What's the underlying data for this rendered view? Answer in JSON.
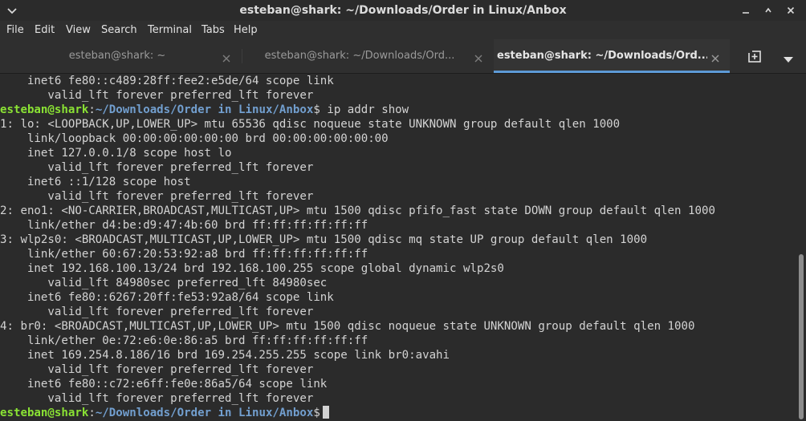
{
  "window": {
    "title": "esteban@shark: ~/Downloads/Order in Linux/Anbox"
  },
  "menu": [
    "File",
    "Edit",
    "View",
    "Search",
    "Terminal",
    "Tabs",
    "Help"
  ],
  "tabs": [
    {
      "label": "esteban@shark: ~",
      "active": false
    },
    {
      "label": "esteban@shark: ~/Downloads/Ord...",
      "active": false
    },
    {
      "label": "esteban@shark: ~/Downloads/Ord...",
      "active": true
    }
  ],
  "prompt": {
    "user_host": "esteban@shark",
    "sep": ":",
    "path": "~/Downloads/Order in Linux/Anbox",
    "dollar": "$"
  },
  "command": " ip addr show",
  "output_before": [
    "    inet6 fe80::c489:28ff:fee2:e5de/64 scope link",
    "       valid_lft forever preferred_lft forever"
  ],
  "output": [
    "1: lo: <LOOPBACK,UP,LOWER_UP> mtu 65536 qdisc noqueue state UNKNOWN group default qlen 1000",
    "    link/loopback 00:00:00:00:00:00 brd 00:00:00:00:00:00",
    "    inet 127.0.0.1/8 scope host lo",
    "       valid_lft forever preferred_lft forever",
    "    inet6 ::1/128 scope host",
    "       valid_lft forever preferred_lft forever",
    "2: eno1: <NO-CARRIER,BROADCAST,MULTICAST,UP> mtu 1500 qdisc pfifo_fast state DOWN group default qlen 1000",
    "    link/ether d4:be:d9:47:4b:60 brd ff:ff:ff:ff:ff:ff",
    "3: wlp2s0: <BROADCAST,MULTICAST,UP,LOWER_UP> mtu 1500 qdisc mq state UP group default qlen 1000",
    "    link/ether 60:67:20:53:92:a8 brd ff:ff:ff:ff:ff:ff",
    "    inet 192.168.100.13/24 brd 192.168.100.255 scope global dynamic wlp2s0",
    "       valid_lft 84980sec preferred_lft 84980sec",
    "    inet6 fe80::6267:20ff:fe53:92a8/64 scope link",
    "       valid_lft forever preferred_lft forever",
    "4: br0: <BROADCAST,MULTICAST,UP,LOWER_UP> mtu 1500 qdisc noqueue state UNKNOWN group default qlen 1000",
    "    link/ether 0e:72:e6:0e:86:a5 brd ff:ff:ff:ff:ff:ff",
    "    inet 169.254.8.186/16 brd 169.254.255.255 scope link br0:avahi",
    "       valid_lft forever preferred_lft forever",
    "    inet6 fe80::c72:e6ff:fe0e:86a5/64 scope link",
    "       valid_lft forever preferred_lft forever"
  ],
  "icons": {
    "window_menu": "chevron-down-icon",
    "minimize": "minimize-icon",
    "maximize": "maximize-icon",
    "close": "close-icon",
    "new_tab": "new-tab-icon",
    "tabs_menu": "triangle-down-icon"
  },
  "colors": {
    "prompt_user": "#8ae234",
    "prompt_path": "#729fcf",
    "tab_active_accent": "#5d9ad6"
  }
}
